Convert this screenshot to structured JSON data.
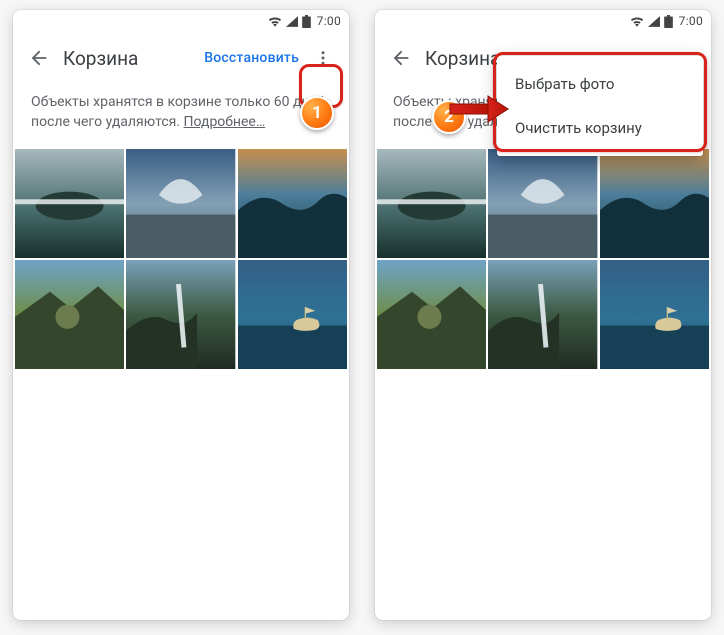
{
  "statusbar": {
    "time": "7:00"
  },
  "appbar": {
    "title": "Корзина",
    "restore_label": "Восстановить"
  },
  "info": {
    "text": "Объекты хранятся в корзине только 60 дней, после чего удаляются.",
    "more_label": "Подробнее…"
  },
  "menu": {
    "select_label": "Выбрать фото",
    "clear_label": "Очистить корзину"
  },
  "badges": {
    "one": "1",
    "two": "2"
  }
}
